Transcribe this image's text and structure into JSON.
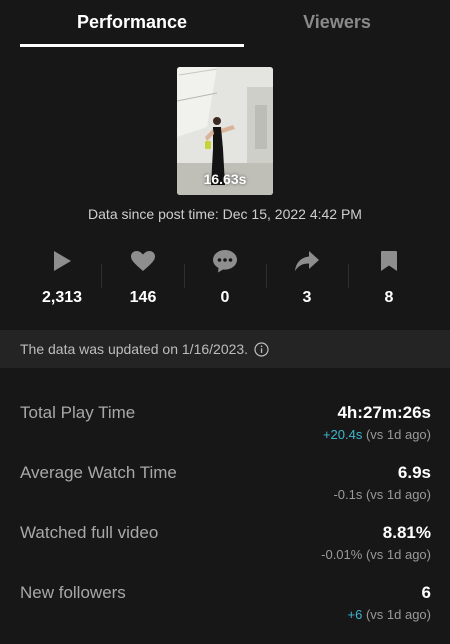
{
  "tabs": [
    {
      "label": "Performance",
      "active": true
    },
    {
      "label": "Viewers",
      "active": false
    }
  ],
  "video": {
    "duration": "16.63s",
    "data_since": "Data since post time: Dec 15, 2022 4:42 PM"
  },
  "stats": [
    {
      "icon": "play-icon",
      "value": "2,313"
    },
    {
      "icon": "heart-icon",
      "value": "146"
    },
    {
      "icon": "comment-icon",
      "value": "0"
    },
    {
      "icon": "share-icon",
      "value": "3"
    },
    {
      "icon": "bookmark-icon",
      "value": "8"
    }
  ],
  "notice": {
    "text": "The data was updated on 1/16/2023.",
    "icon": "info-icon"
  },
  "metrics": [
    {
      "label": "Total Play Time",
      "value": "4h:27m:26s",
      "change": "+20.4s",
      "change_suffix": " (vs 1d ago)",
      "positive": true
    },
    {
      "label": "Average Watch Time",
      "value": "6.9s",
      "change": "-0.1s",
      "change_suffix": " (vs 1d ago)",
      "positive": false
    },
    {
      "label": "Watched full video",
      "value": "8.81%",
      "change": "-0.01%",
      "change_suffix": " (vs 1d ago)",
      "positive": false
    },
    {
      "label": "New followers",
      "value": "6",
      "change": "+6",
      "change_suffix": " (vs 1d ago)",
      "positive": true
    }
  ],
  "colors": {
    "background": "#171717",
    "positive_delta": "#3fb6cf",
    "icon_gray": "#8e8e8e"
  }
}
